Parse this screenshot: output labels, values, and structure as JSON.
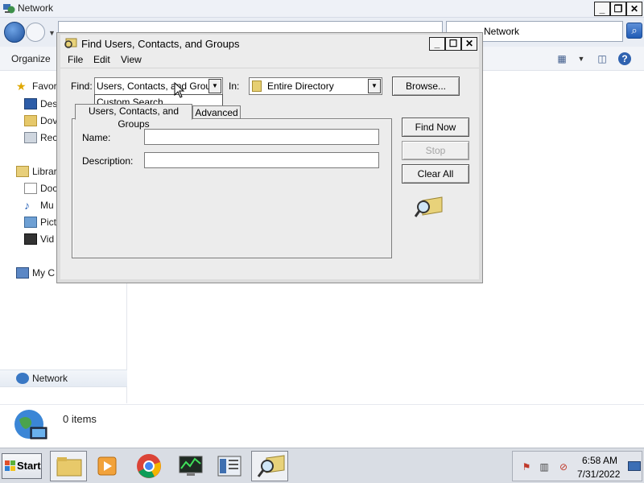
{
  "explorer": {
    "title": "Network",
    "search_value": "Network",
    "toolbar": {
      "organize_label": "Organize"
    },
    "nav": {
      "favorites": "Favor",
      "favorites_items": [
        "Des",
        "Dov",
        "Rec"
      ],
      "libraries": "Librar",
      "libraries_items": [
        "Doc",
        "Mu",
        "Pict",
        "Vid"
      ],
      "computer": "My C",
      "network": "Network"
    },
    "details": {
      "items_count": "0 items"
    }
  },
  "dialog": {
    "title": "Find Users, Contacts, and Groups",
    "menu": [
      "File",
      "Edit",
      "View"
    ],
    "find_label": "Find:",
    "find_value": "Users, Contacts, and Groups",
    "find_dropdown_option": "Custom Search",
    "in_label": "In:",
    "in_value": "Entire Directory",
    "browse_label": "Browse...",
    "tabs": [
      "Users, Contacts, and Groups",
      "Advanced"
    ],
    "name_label": "Name:",
    "name_value": "",
    "description_label": "Description:",
    "description_value": "",
    "buttons": {
      "find_now": "Find Now",
      "stop": "Stop",
      "clear_all": "Clear All"
    }
  },
  "taskbar": {
    "start_label": "Start",
    "clock_time": "6:58 AM",
    "clock_date": "7/31/2022"
  }
}
